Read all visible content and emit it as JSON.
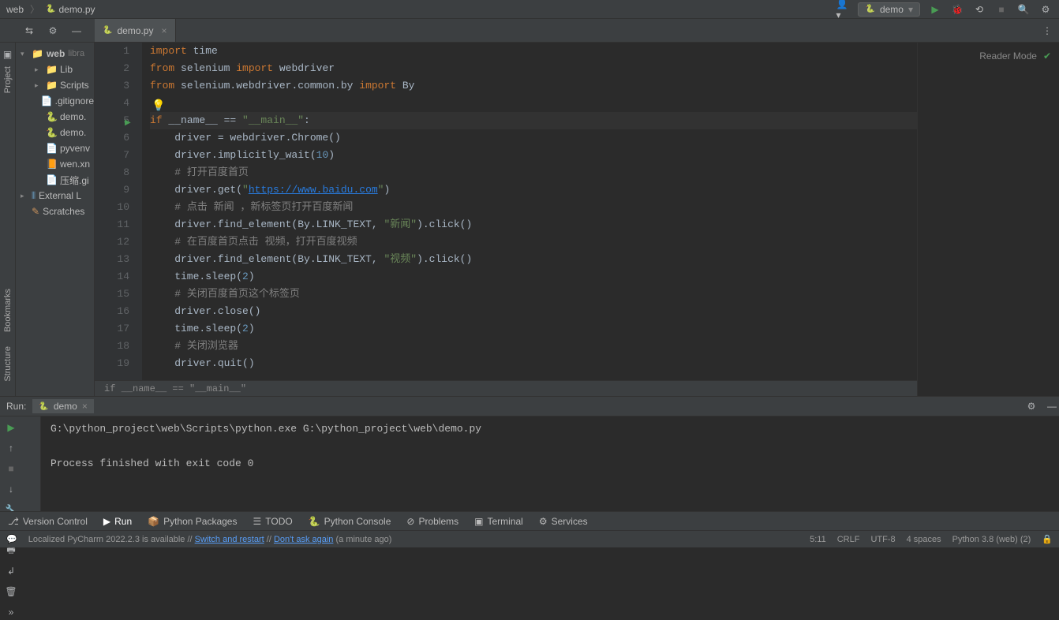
{
  "breadcrumbs": {
    "root": "web",
    "file": "demo.py"
  },
  "run_config": {
    "name": "demo"
  },
  "project_tree": {
    "root": {
      "name": "web",
      "lib": "libra"
    },
    "items": [
      {
        "name": "Lib",
        "type": "folder",
        "indent": 1
      },
      {
        "name": "Scripts",
        "type": "folder",
        "indent": 1
      },
      {
        "name": ".gitignore",
        "type": "file",
        "indent": 1
      },
      {
        "name": "demo.",
        "type": "py",
        "indent": 1
      },
      {
        "name": "demo.",
        "type": "py",
        "indent": 1
      },
      {
        "name": "pyvenv",
        "type": "file",
        "indent": 1
      },
      {
        "name": "wen.xn",
        "type": "xml",
        "indent": 1
      },
      {
        "name": "压缩.gi",
        "type": "file",
        "indent": 1
      }
    ],
    "external": "External L",
    "scratches": "Scratches"
  },
  "editor": {
    "tab": "demo.py",
    "reader_mode": "Reader Mode",
    "context_hint": "if __name__ == \"__main__\"",
    "code": [
      {
        "n": 1,
        "segs": [
          [
            "kw",
            "import"
          ],
          [
            "",
            " time"
          ]
        ]
      },
      {
        "n": 2,
        "segs": [
          [
            "kw",
            "from"
          ],
          [
            "",
            " selenium "
          ],
          [
            "kw",
            "import"
          ],
          [
            "",
            " webdriver"
          ]
        ]
      },
      {
        "n": 3,
        "segs": [
          [
            "kw",
            "from"
          ],
          [
            "",
            " selenium.webdriver.common.by "
          ],
          [
            "kw",
            "import"
          ],
          [
            "",
            " By"
          ]
        ]
      },
      {
        "n": 4,
        "segs": [
          [
            "",
            ""
          ]
        ]
      },
      {
        "n": 5,
        "segs": [
          [
            "kw",
            "if"
          ],
          [
            "",
            " __name__ == "
          ],
          [
            "str",
            "\"__main__\""
          ],
          [
            "",
            ":"
          ]
        ],
        "active": true,
        "run": true
      },
      {
        "n": 6,
        "segs": [
          [
            "",
            "    driver = webdriver.Chrome()"
          ]
        ]
      },
      {
        "n": 7,
        "segs": [
          [
            "",
            "    driver.implicitly_wait("
          ],
          [
            "num",
            "10"
          ],
          [
            "",
            ")"
          ]
        ]
      },
      {
        "n": 8,
        "segs": [
          [
            "",
            "    "
          ],
          [
            "cmt",
            "# 打开百度首页"
          ]
        ]
      },
      {
        "n": 9,
        "segs": [
          [
            "",
            "    driver.get("
          ],
          [
            "str",
            "\""
          ],
          [
            "url",
            "https://www.baidu.com"
          ],
          [
            "str",
            "\""
          ],
          [
            "",
            ")"
          ]
        ]
      },
      {
        "n": 10,
        "segs": [
          [
            "",
            "    "
          ],
          [
            "cmt",
            "# 点击 新闻 ，新标签页打开百度新闻"
          ]
        ]
      },
      {
        "n": 11,
        "segs": [
          [
            "",
            "    driver.find_element(By.LINK_TEXT"
          ],
          [
            "",
            ", "
          ],
          [
            "str",
            "\"新闻\""
          ],
          [
            "",
            "].click()"
          ]
        ],
        "raw": "    driver.find_element(By.LINK_TEXT, \"新闻\").click()"
      },
      {
        "n": 12,
        "segs": [
          [
            "",
            "    "
          ],
          [
            "cmt",
            "# 在百度首页点击 视频，打开百度视频"
          ]
        ]
      },
      {
        "n": 13,
        "segs": [
          [
            "",
            "    driver.find_element(By.LINK_TEXT"
          ],
          [
            "",
            ", "
          ],
          [
            "str",
            "\"视频\""
          ],
          [
            "",
            "].click()"
          ]
        ],
        "raw": "    driver.find_element(By.LINK_TEXT, \"视频\").click()"
      },
      {
        "n": 14,
        "segs": [
          [
            "",
            "    time.sleep("
          ],
          [
            "num",
            "2"
          ],
          [
            "",
            ")"
          ]
        ]
      },
      {
        "n": 15,
        "segs": [
          [
            "",
            "    "
          ],
          [
            "cmt",
            "# 关闭百度首页这个标签页"
          ]
        ]
      },
      {
        "n": 16,
        "segs": [
          [
            "",
            "    driver.close()"
          ]
        ]
      },
      {
        "n": 17,
        "segs": [
          [
            "",
            "    time.sleep("
          ],
          [
            "num",
            "2"
          ],
          [
            "",
            ")"
          ]
        ]
      },
      {
        "n": 18,
        "segs": [
          [
            "",
            "    "
          ],
          [
            "cmt",
            "# 关闭浏览器"
          ]
        ]
      },
      {
        "n": 19,
        "segs": [
          [
            "",
            "    driver.quit()"
          ]
        ]
      }
    ]
  },
  "left_rail": {
    "project": "Project",
    "bookmarks": "Bookmarks",
    "structure": "Structure"
  },
  "run_panel": {
    "title": "Run:",
    "tab": "demo",
    "output": [
      "G:\\python_project\\web\\Scripts\\python.exe G:\\python_project\\web\\demo.py",
      "",
      "Process finished with exit code 0",
      ""
    ]
  },
  "bottom_tabs": {
    "vcs": "Version Control",
    "run": "Run",
    "pkgs": "Python Packages",
    "todo": "TODO",
    "console": "Python Console",
    "problems": "Problems",
    "terminal": "Terminal",
    "services": "Services"
  },
  "status_bar": {
    "msg_pre": "Localized PyCharm 2022.2.3 is available // ",
    "link1": "Switch and restart",
    "sep": " // ",
    "link2": "Don't ask again",
    "msg_post": " (a minute ago)",
    "pos": "5:11",
    "sep2": "CRLF",
    "enc": "UTF-8",
    "indent": "4 spaces",
    "interp": "Python 3.8 (web) (2)"
  }
}
